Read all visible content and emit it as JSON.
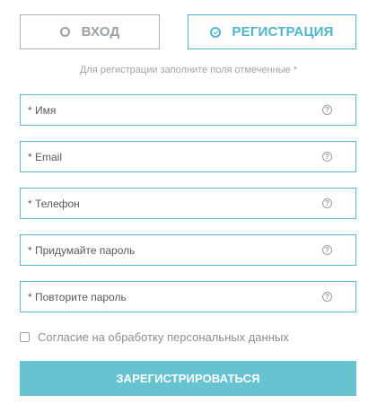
{
  "tabs": {
    "login": {
      "label": "ВХОД",
      "icon": "radio-circle-icon"
    },
    "register": {
      "label": "РЕГИСТРАЦИЯ",
      "icon": "check-circle-icon",
      "active": true
    }
  },
  "hint": "Для регистрации заполните поля отмеченные *",
  "fields": {
    "name": {
      "placeholder": "* Имя"
    },
    "email": {
      "placeholder": "* Email"
    },
    "phone": {
      "placeholder": "* Телефон"
    },
    "password": {
      "placeholder": "* Придумайте пароль"
    },
    "password_repeat": {
      "placeholder": "* Повторите пароль"
    },
    "help_glyph": "?"
  },
  "consent": {
    "label": "Согласие на обработку персональных данных",
    "checked": false
  },
  "submit": {
    "label": "ЗАРЕГИСТРИРОВАТЬСЯ"
  },
  "colors": {
    "accent": "#4fb6c9",
    "button": "#67c3d0",
    "muted": "#9aa0a4"
  }
}
